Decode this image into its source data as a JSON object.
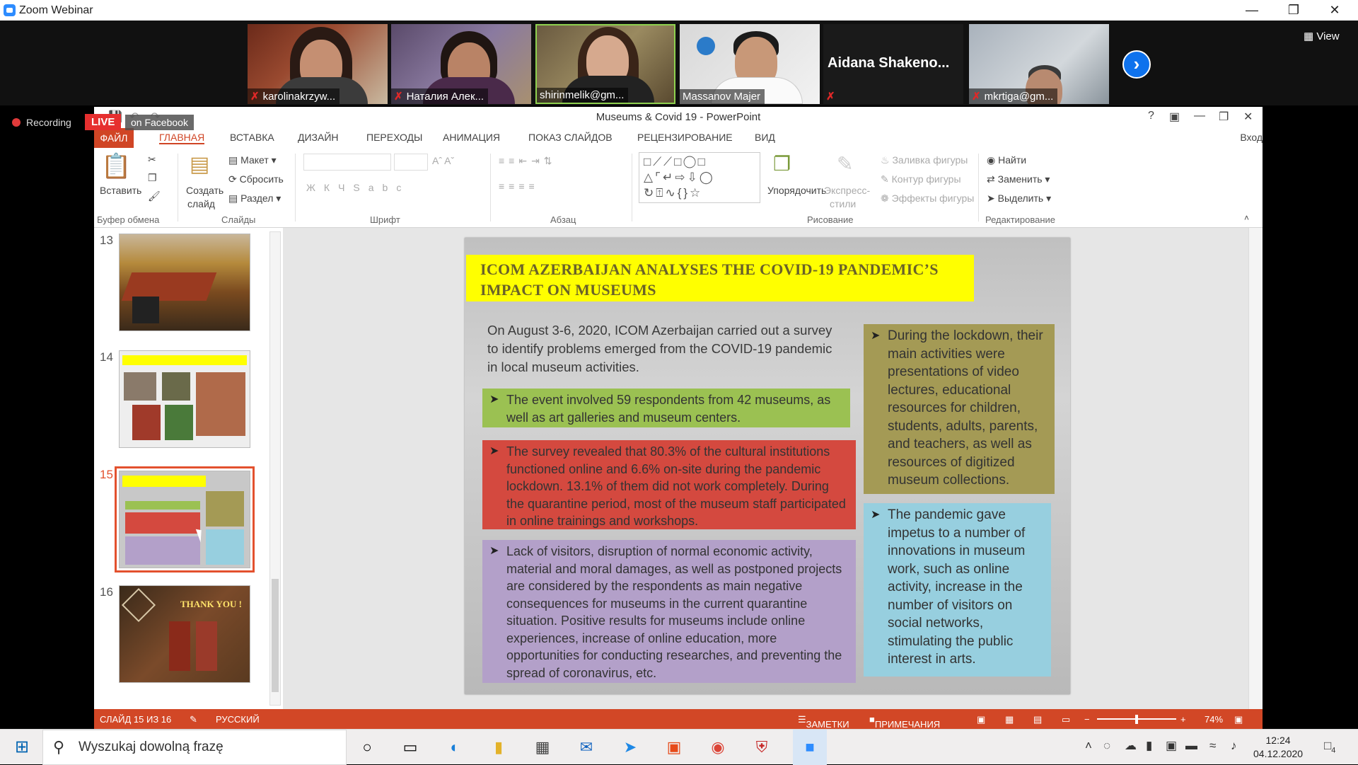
{
  "zoom": {
    "title": "Zoom Webinar",
    "view_label": "View",
    "recording_label": "Recording",
    "live_label": "LIVE",
    "live_target": "on Facebook",
    "participants": [
      {
        "name": "karolinakrzyw...",
        "muted": true
      },
      {
        "name": "Наталия Алек...",
        "muted": true
      },
      {
        "name": "shirinmelik@gm...",
        "muted": false
      },
      {
        "name": "Massanov Majer",
        "muted": false
      },
      {
        "name": "Aidana  Shakeno...",
        "muted": true
      },
      {
        "name": "mkrtiga@gm...",
        "muted": true
      }
    ]
  },
  "powerpoint": {
    "title": "Museums & Covid 19 - PowerPoint",
    "sign_in": "Вход",
    "tabs": [
      "ФАЙЛ",
      "ГЛАВНАЯ",
      "ВСТАВКА",
      "ДИЗАЙН",
      "ПЕРЕХОДЫ",
      "АНИМАЦИЯ",
      "ПОКАЗ СЛАЙДОВ",
      "РЕЦЕНЗИРОВАНИЕ",
      "ВИД"
    ],
    "ribbon": {
      "paste": "Вставить",
      "new_slide_1": "Создать",
      "new_slide_2": "слайд",
      "layout": "Макет",
      "reset": "Сбросить",
      "section": "Раздел",
      "arrange": "Упорядочить",
      "quick_styles_1": "Экспресс-",
      "quick_styles_2": "стили",
      "shape_fill": "Заливка фигуры",
      "shape_outline": "Контур фигуры",
      "shape_effects": "Эффекты фигуры",
      "find": "Найти",
      "replace": "Заменить",
      "select": "Выделить",
      "groups": {
        "clipboard": "Буфер обмена",
        "slides": "Слайды",
        "font": "Шрифт",
        "paragraph": "Абзац",
        "drawing": "Рисование",
        "editing": "Редактирование"
      }
    },
    "thumbnails": [
      {
        "num": "13"
      },
      {
        "num": "14"
      },
      {
        "num": "15"
      },
      {
        "num": "16",
        "text": "THANK YOU !"
      }
    ],
    "slide": {
      "title": "ICOM AZERBAIJAN ANALYSES THE COVID-19 PANDEMIC’S IMPACT ON MUSEUMS",
      "intro": "On August 3-6, 2020, ICOM Azerbaijan carried out a survey to identify problems emerged from the COVID-19 pandemic in local museum activities.",
      "green": "The event involved 59 respondents from 42 museums, as well as art galleries and museum centers.",
      "red": "The survey revealed that 80.3% of the cultural institutions functioned online and 6.6% on-site during the pandemic lockdown. 13.1% of them did not work completely. During the quarantine period, most of the museum staff participated in online trainings and workshops.",
      "purple": "Lack of visitors, disruption of normal economic activity, material and moral damages, as well as postponed projects are considered by the respondents as  main negative consequences for museums in the current quarantine situation. Positive results for museums include online experiences, increase of online education, more opportunities for conducting researches, and preventing the spread of coronavirus, etc.",
      "olive": "During the lockdown, their main activities were presentations of video lectures, educational resources for children, students, adults, parents, and teachers, as well as resources of digitized museum collections.",
      "blue": "The pandemic gave impetus to a number of innovations in museum work, such as online activity, increase in the number of visitors on social networks, stimulating the public interest in arts.",
      "colors": {
        "title_bg": "#ffff00",
        "green": "#9bc152",
        "red": "#d4493f",
        "purple": "#b3a0c9",
        "olive": "#a49a55",
        "blue": "#97cfdf"
      }
    },
    "status": {
      "slide_of": "СЛАЙД 15 ИЗ 16",
      "language": "РУССКИЙ",
      "notes": "ЗАМЕТКИ",
      "comments": "ПРИМЕЧАНИЯ",
      "zoom": "74%"
    }
  },
  "taskbar": {
    "search_placeholder": "Wyszukaj dowolną frazę",
    "time": "12:24",
    "date": "04.12.2020",
    "notifications": "4"
  }
}
